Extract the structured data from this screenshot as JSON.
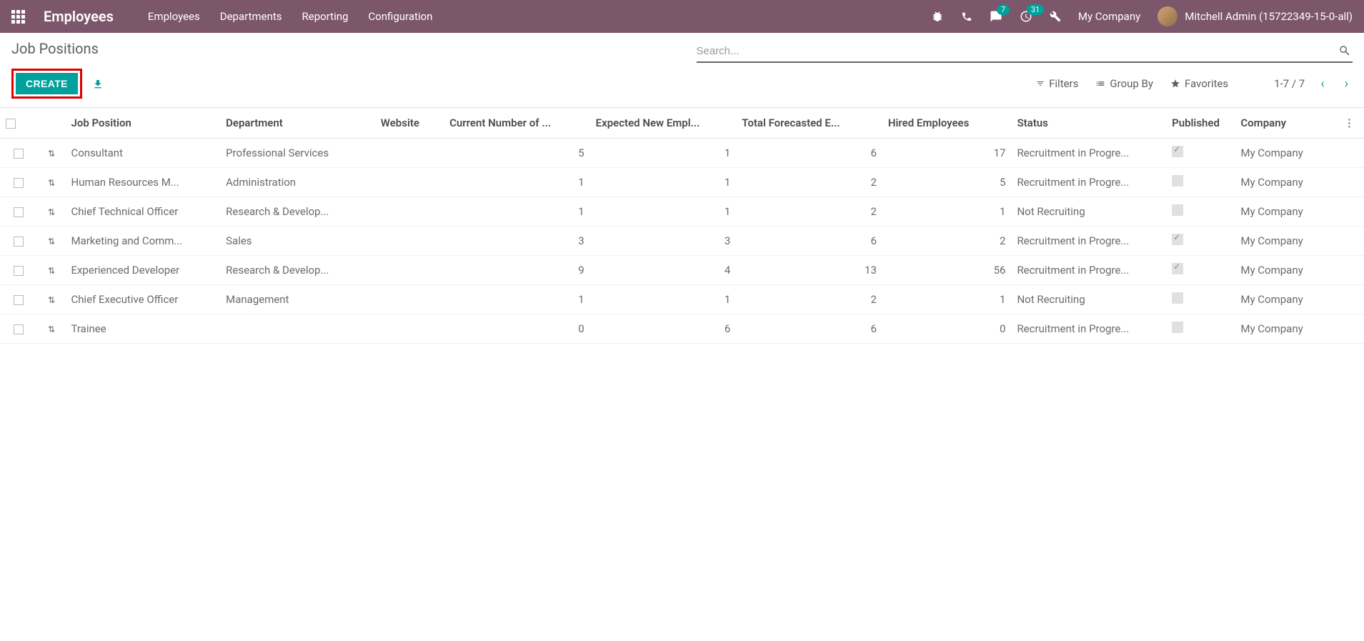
{
  "header": {
    "app_name": "Employees",
    "menu": [
      "Employees",
      "Departments",
      "Reporting",
      "Configuration"
    ],
    "msg_count": "7",
    "activity_count": "31",
    "company": "My Company",
    "user": "Mitchell Admin (15722349-15-0-all)"
  },
  "breadcrumb": "Job Positions",
  "buttons": {
    "create": "CREATE",
    "filters": "Filters",
    "groupby": "Group By",
    "favorites": "Favorites"
  },
  "search": {
    "placeholder": "Search..."
  },
  "pager": {
    "text": "1-7 / 7"
  },
  "columns": {
    "job": "Job Position",
    "dept": "Department",
    "website": "Website",
    "current": "Current Number of ...",
    "expected": "Expected New Empl...",
    "forecast": "Total Forecasted E...",
    "hired": "Hired Employees",
    "status": "Status",
    "published": "Published",
    "company": "Company"
  },
  "rows": [
    {
      "job": "Consultant",
      "dept": "Professional Services",
      "website": "",
      "current": "5",
      "expected": "1",
      "forecast": "6",
      "hired": "17",
      "status": "Recruitment in Progre...",
      "published": true,
      "company": "My Company"
    },
    {
      "job": "Human Resources M...",
      "dept": "Administration",
      "website": "",
      "current": "1",
      "expected": "1",
      "forecast": "2",
      "hired": "5",
      "status": "Recruitment in Progre...",
      "published": false,
      "company": "My Company"
    },
    {
      "job": "Chief Technical Officer",
      "dept": "Research & Develop...",
      "website": "",
      "current": "1",
      "expected": "1",
      "forecast": "2",
      "hired": "1",
      "status": "Not Recruiting",
      "published": false,
      "company": "My Company"
    },
    {
      "job": "Marketing and Comm...",
      "dept": "Sales",
      "website": "",
      "current": "3",
      "expected": "3",
      "forecast": "6",
      "hired": "2",
      "status": "Recruitment in Progre...",
      "published": true,
      "company": "My Company"
    },
    {
      "job": "Experienced Developer",
      "dept": "Research & Develop...",
      "website": "",
      "current": "9",
      "expected": "4",
      "forecast": "13",
      "hired": "56",
      "status": "Recruitment in Progre...",
      "published": true,
      "company": "My Company"
    },
    {
      "job": "Chief Executive Officer",
      "dept": "Management",
      "website": "",
      "current": "1",
      "expected": "1",
      "forecast": "2",
      "hired": "1",
      "status": "Not Recruiting",
      "published": false,
      "company": "My Company"
    },
    {
      "job": "Trainee",
      "dept": "",
      "website": "",
      "current": "0",
      "expected": "6",
      "forecast": "6",
      "hired": "0",
      "status": "Recruitment in Progre...",
      "published": false,
      "company": "My Company"
    }
  ]
}
